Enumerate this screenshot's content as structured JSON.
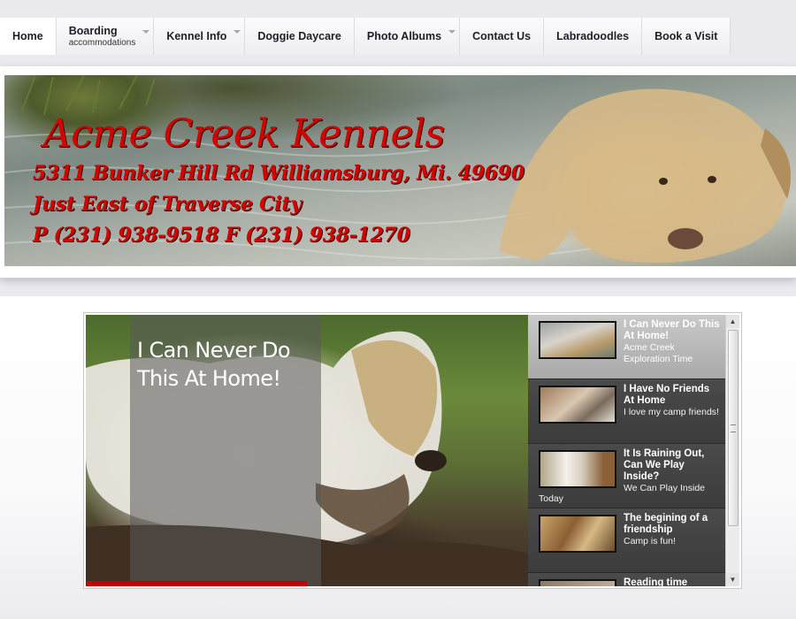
{
  "nav": {
    "items": [
      {
        "label": "Home",
        "sub": ""
      },
      {
        "label": "Boarding",
        "sub": "accommodations"
      },
      {
        "label": "Kennel Info",
        "sub": ""
      },
      {
        "label": "Doggie Daycare",
        "sub": ""
      },
      {
        "label": "Photo Albums",
        "sub": ""
      },
      {
        "label": "Contact Us",
        "sub": ""
      },
      {
        "label": "Labradoodles",
        "sub": ""
      },
      {
        "label": "Book a Visit",
        "sub": ""
      }
    ]
  },
  "banner": {
    "title": "Acme Creek Kennels",
    "address": "5311 Bunker Hill Rd  Williamsburg, Mi. 49690",
    "location": "Just East of Traverse City",
    "phone": "P (231) 938-9518  F (231) 938-1270"
  },
  "slider": {
    "caption": "I Can Never Do This At Home!",
    "items": [
      {
        "title": "I Can Never Do This At Home!",
        "desc": "Acme Creek Exploration Time"
      },
      {
        "title": "I Have No Friends At Home",
        "desc": "I love my camp friends!"
      },
      {
        "title": "It Is Raining Out, Can We Play Inside?",
        "desc": "We Can Play Inside",
        "overflow": "Today"
      },
      {
        "title": "The begining of a friendship",
        "desc": "Camp is fun!"
      },
      {
        "title": "Reading time",
        "desc": ""
      }
    ]
  },
  "colors": {
    "banner_text": "#d40000",
    "progress": "#c40000"
  },
  "icons": {
    "scroll_up": "triangle-up-icon",
    "scroll_down": "triangle-down-icon",
    "submenu": "chevron-down-icon"
  }
}
